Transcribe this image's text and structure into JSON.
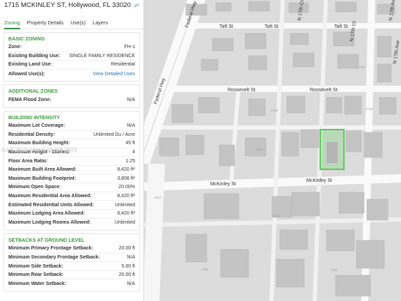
{
  "header": {
    "address": "1715 MCKINLEY ST, Hollywood, FL 33020"
  },
  "tabs": [
    {
      "label": "Zoning",
      "active": true
    },
    {
      "label": "Property Details",
      "active": false
    },
    {
      "label": "Use(s)",
      "active": false
    },
    {
      "label": "Layers",
      "active": false
    }
  ],
  "basic_zoning": {
    "title": "BASIC ZONING",
    "zone_label": "Zone:",
    "zone_value": "FH-1",
    "existing_building_use_label": "Existing Building Use:",
    "existing_building_use_value": "SINGLE FAMILY RESIDENCE",
    "existing_land_use_label": "Existing Land Use:",
    "existing_land_use_value": "Residential",
    "allowed_uses_label": "Allowed Use(s):",
    "allowed_uses_value": "View Detailed Uses"
  },
  "additional_zones": {
    "title": "ADDITIONAL ZONES",
    "fema_label": "FEMA Flood Zone:",
    "fema_value": "N/A"
  },
  "building_intensity": {
    "title": "BUILDING INTENSITY",
    "rows": [
      {
        "label": "Maximum Lot Coverage:",
        "value": "N/A"
      },
      {
        "label": "Residential Density:",
        "value": "Unlimited Du / Acre"
      },
      {
        "label": "Maximum Building Height:",
        "value": "45 ft"
      },
      {
        "label": "Maximum Height - Stories:",
        "value": "4"
      },
      {
        "label": "Floor Area Ratio:",
        "value": "1.25"
      },
      {
        "label": "Maximum Built Area Allowed:",
        "value": "8,420 ft²"
      },
      {
        "label": "Maximum Building Footprint:",
        "value": "3,808 ft²"
      },
      {
        "label": "Minimum Open Space:",
        "value": "20.00%"
      },
      {
        "label": "Maximum Residential Area Allowed:",
        "value": "8,420 ft²"
      },
      {
        "label": "Estimated Residential Units Allowed:",
        "value": "Unlimited"
      },
      {
        "label": "Maximum Lodging Area Allowed:",
        "value": "8,420 ft²"
      },
      {
        "label": "Maximum Lodging Rooms Allowed:",
        "value": "Unlimited"
      }
    ]
  },
  "setbacks": {
    "title": "SETBACKS AT GROUND LEVEL",
    "rows": [
      {
        "label": "Minimum Primary Frontage Setback:",
        "value": "20.00 ft"
      },
      {
        "label": "Minimum Secondary Frontage Setback:",
        "value": "N/A"
      },
      {
        "label": "Minimum Side Setback:",
        "value": "5.00 ft"
      },
      {
        "label": "Minimum Rear Setback:",
        "value": "20.00 ft"
      },
      {
        "label": "Minimum Water Setback:",
        "value": "N/A"
      }
    ]
  },
  "watermark": "A1 © 2023 Miami MLS® 2023",
  "map": {
    "roads": {
      "federal_hwy_1": "Federal Hwy",
      "federal_hwy_2": "Federal Hwy",
      "taft_1": "Taft St",
      "taft_2": "Taft St",
      "taft_3": "Taft St",
      "roosevelt_1": "Roosevelt St",
      "roosevelt_2": "Roosevelt St",
      "mckinley_1": "McKinley St",
      "mckinley_2": "McKinley St",
      "n17th_1": "N 17th Ct",
      "n17th_2": "N 17th Ave",
      "n17th_3": "N 17th Ct",
      "n17th_4": "N 17th Ave"
    },
    "lot_numbers": [
      "1707",
      "1726",
      "1716",
      "1721",
      "1413",
      "1724",
      "1749",
      "1713"
    ],
    "colors": {
      "selected_parcel": "#5cc95c",
      "road": "#ffffff",
      "background": "#dedede",
      "building": "#c2c2c2"
    }
  }
}
